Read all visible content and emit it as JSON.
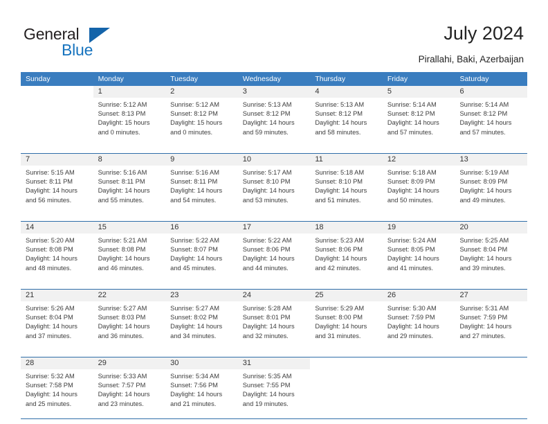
{
  "brand": {
    "name_part1": "General",
    "name_part2": "Blue",
    "color_dark": "#231f20",
    "color_blue": "#1673be"
  },
  "header": {
    "title": "July 2024",
    "subtitle": "Pirallahi, Baki, Azerbaijan"
  },
  "calendar": {
    "header_bg": "#3a7dbf",
    "row_rule_color": "#2e6da8",
    "daynum_bg": "#f1f1f1",
    "weekdays": [
      "Sunday",
      "Monday",
      "Tuesday",
      "Wednesday",
      "Thursday",
      "Friday",
      "Saturday"
    ],
    "weeks": [
      [
        {
          "day": "",
          "sunrise": "",
          "sunset": "",
          "daylight_1": "",
          "daylight_2": ""
        },
        {
          "day": "1",
          "sunrise": "Sunrise: 5:12 AM",
          "sunset": "Sunset: 8:13 PM",
          "daylight_1": "Daylight: 15 hours",
          "daylight_2": "and 0 minutes."
        },
        {
          "day": "2",
          "sunrise": "Sunrise: 5:12 AM",
          "sunset": "Sunset: 8:12 PM",
          "daylight_1": "Daylight: 15 hours",
          "daylight_2": "and 0 minutes."
        },
        {
          "day": "3",
          "sunrise": "Sunrise: 5:13 AM",
          "sunset": "Sunset: 8:12 PM",
          "daylight_1": "Daylight: 14 hours",
          "daylight_2": "and 59 minutes."
        },
        {
          "day": "4",
          "sunrise": "Sunrise: 5:13 AM",
          "sunset": "Sunset: 8:12 PM",
          "daylight_1": "Daylight: 14 hours",
          "daylight_2": "and 58 minutes."
        },
        {
          "day": "5",
          "sunrise": "Sunrise: 5:14 AM",
          "sunset": "Sunset: 8:12 PM",
          "daylight_1": "Daylight: 14 hours",
          "daylight_2": "and 57 minutes."
        },
        {
          "day": "6",
          "sunrise": "Sunrise: 5:14 AM",
          "sunset": "Sunset: 8:12 PM",
          "daylight_1": "Daylight: 14 hours",
          "daylight_2": "and 57 minutes."
        }
      ],
      [
        {
          "day": "7",
          "sunrise": "Sunrise: 5:15 AM",
          "sunset": "Sunset: 8:11 PM",
          "daylight_1": "Daylight: 14 hours",
          "daylight_2": "and 56 minutes."
        },
        {
          "day": "8",
          "sunrise": "Sunrise: 5:16 AM",
          "sunset": "Sunset: 8:11 PM",
          "daylight_1": "Daylight: 14 hours",
          "daylight_2": "and 55 minutes."
        },
        {
          "day": "9",
          "sunrise": "Sunrise: 5:16 AM",
          "sunset": "Sunset: 8:11 PM",
          "daylight_1": "Daylight: 14 hours",
          "daylight_2": "and 54 minutes."
        },
        {
          "day": "10",
          "sunrise": "Sunrise: 5:17 AM",
          "sunset": "Sunset: 8:10 PM",
          "daylight_1": "Daylight: 14 hours",
          "daylight_2": "and 53 minutes."
        },
        {
          "day": "11",
          "sunrise": "Sunrise: 5:18 AM",
          "sunset": "Sunset: 8:10 PM",
          "daylight_1": "Daylight: 14 hours",
          "daylight_2": "and 51 minutes."
        },
        {
          "day": "12",
          "sunrise": "Sunrise: 5:18 AM",
          "sunset": "Sunset: 8:09 PM",
          "daylight_1": "Daylight: 14 hours",
          "daylight_2": "and 50 minutes."
        },
        {
          "day": "13",
          "sunrise": "Sunrise: 5:19 AM",
          "sunset": "Sunset: 8:09 PM",
          "daylight_1": "Daylight: 14 hours",
          "daylight_2": "and 49 minutes."
        }
      ],
      [
        {
          "day": "14",
          "sunrise": "Sunrise: 5:20 AM",
          "sunset": "Sunset: 8:08 PM",
          "daylight_1": "Daylight: 14 hours",
          "daylight_2": "and 48 minutes."
        },
        {
          "day": "15",
          "sunrise": "Sunrise: 5:21 AM",
          "sunset": "Sunset: 8:08 PM",
          "daylight_1": "Daylight: 14 hours",
          "daylight_2": "and 46 minutes."
        },
        {
          "day": "16",
          "sunrise": "Sunrise: 5:22 AM",
          "sunset": "Sunset: 8:07 PM",
          "daylight_1": "Daylight: 14 hours",
          "daylight_2": "and 45 minutes."
        },
        {
          "day": "17",
          "sunrise": "Sunrise: 5:22 AM",
          "sunset": "Sunset: 8:06 PM",
          "daylight_1": "Daylight: 14 hours",
          "daylight_2": "and 44 minutes."
        },
        {
          "day": "18",
          "sunrise": "Sunrise: 5:23 AM",
          "sunset": "Sunset: 8:06 PM",
          "daylight_1": "Daylight: 14 hours",
          "daylight_2": "and 42 minutes."
        },
        {
          "day": "19",
          "sunrise": "Sunrise: 5:24 AM",
          "sunset": "Sunset: 8:05 PM",
          "daylight_1": "Daylight: 14 hours",
          "daylight_2": "and 41 minutes."
        },
        {
          "day": "20",
          "sunrise": "Sunrise: 5:25 AM",
          "sunset": "Sunset: 8:04 PM",
          "daylight_1": "Daylight: 14 hours",
          "daylight_2": "and 39 minutes."
        }
      ],
      [
        {
          "day": "21",
          "sunrise": "Sunrise: 5:26 AM",
          "sunset": "Sunset: 8:04 PM",
          "daylight_1": "Daylight: 14 hours",
          "daylight_2": "and 37 minutes."
        },
        {
          "day": "22",
          "sunrise": "Sunrise: 5:27 AM",
          "sunset": "Sunset: 8:03 PM",
          "daylight_1": "Daylight: 14 hours",
          "daylight_2": "and 36 minutes."
        },
        {
          "day": "23",
          "sunrise": "Sunrise: 5:27 AM",
          "sunset": "Sunset: 8:02 PM",
          "daylight_1": "Daylight: 14 hours",
          "daylight_2": "and 34 minutes."
        },
        {
          "day": "24",
          "sunrise": "Sunrise: 5:28 AM",
          "sunset": "Sunset: 8:01 PM",
          "daylight_1": "Daylight: 14 hours",
          "daylight_2": "and 32 minutes."
        },
        {
          "day": "25",
          "sunrise": "Sunrise: 5:29 AM",
          "sunset": "Sunset: 8:00 PM",
          "daylight_1": "Daylight: 14 hours",
          "daylight_2": "and 31 minutes."
        },
        {
          "day": "26",
          "sunrise": "Sunrise: 5:30 AM",
          "sunset": "Sunset: 7:59 PM",
          "daylight_1": "Daylight: 14 hours",
          "daylight_2": "and 29 minutes."
        },
        {
          "day": "27",
          "sunrise": "Sunrise: 5:31 AM",
          "sunset": "Sunset: 7:59 PM",
          "daylight_1": "Daylight: 14 hours",
          "daylight_2": "and 27 minutes."
        }
      ],
      [
        {
          "day": "28",
          "sunrise": "Sunrise: 5:32 AM",
          "sunset": "Sunset: 7:58 PM",
          "daylight_1": "Daylight: 14 hours",
          "daylight_2": "and 25 minutes."
        },
        {
          "day": "29",
          "sunrise": "Sunrise: 5:33 AM",
          "sunset": "Sunset: 7:57 PM",
          "daylight_1": "Daylight: 14 hours",
          "daylight_2": "and 23 minutes."
        },
        {
          "day": "30",
          "sunrise": "Sunrise: 5:34 AM",
          "sunset": "Sunset: 7:56 PM",
          "daylight_1": "Daylight: 14 hours",
          "daylight_2": "and 21 minutes."
        },
        {
          "day": "31",
          "sunrise": "Sunrise: 5:35 AM",
          "sunset": "Sunset: 7:55 PM",
          "daylight_1": "Daylight: 14 hours",
          "daylight_2": "and 19 minutes."
        },
        {
          "day": "",
          "sunrise": "",
          "sunset": "",
          "daylight_1": "",
          "daylight_2": ""
        },
        {
          "day": "",
          "sunrise": "",
          "sunset": "",
          "daylight_1": "",
          "daylight_2": ""
        },
        {
          "day": "",
          "sunrise": "",
          "sunset": "",
          "daylight_1": "",
          "daylight_2": ""
        }
      ]
    ]
  }
}
